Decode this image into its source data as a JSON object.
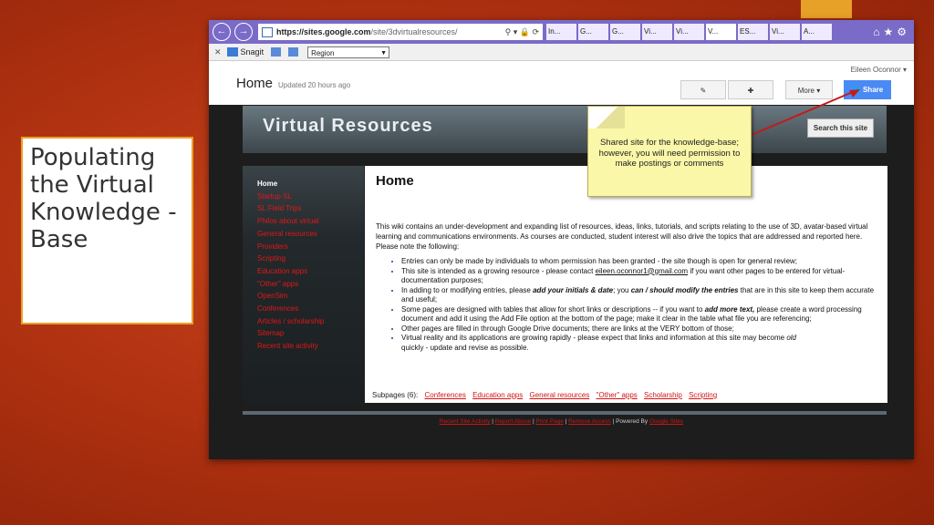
{
  "slide": {
    "text": "Populating the Virtual Knowledge -Base",
    "accent_color": "#e8a128"
  },
  "browser": {
    "url_host": "https://sites.google.com",
    "url_path": "/site/3dvirtualresources/",
    "tabs": [
      "In...",
      "G...",
      "G...",
      "Vi...",
      "Vi...",
      "V...",
      "ES...",
      "Vi...",
      "A..."
    ],
    "snagit_label": "Snagit",
    "region_value": "Region"
  },
  "sites": {
    "user_name": "Eileen Oconnor",
    "page_title": "Home",
    "updated": "Updated 20 hours ago",
    "more_label": "More",
    "share_label": "Share",
    "site_title": "Virtual Resources",
    "search_label": "Search this site",
    "sidebar_items": [
      "Home",
      "Startup SL",
      "SL Field Trips",
      "Philos about virtual",
      "General resources",
      "Providers",
      "Scripting",
      "Education apps",
      "\"Other\" apps",
      "OpenSim",
      "Conferences",
      "Articles / scholarship",
      "Sitemap",
      "Recent site activity"
    ],
    "content_heading": "Home",
    "intro": "This wiki contains an under-development and expanding list of resources, ideas, links, tutorials, and scripts relating to the use of 3D, avatar-based virtual learning and communications environments.  As courses are conducted, student interest will also drive the topics that are addressed and reported here.  Please note the following:",
    "bullet1": "Entries can only be made by individuals to whom permission has been granted - the site though is open for general review;",
    "bullet2_a": "This site is intended as a growing resource - please contact",
    "bullet2_link": "eileen.oconnor1@gmail.com",
    "bullet2_b": "if you want other pages to be entered for virtual-documentation purposes;",
    "bullet3_a": "In adding to or modifying entries, please",
    "bullet3_red": "add your initials & date",
    "bullet3_b": "; you",
    "bullet3_bi": "can / should modify the entries",
    "bullet3_c": "that are in this site to keep them accurate and useful;",
    "bullet4_a": "Some pages are designed with tables that allow for short links or descriptions -- if you want to",
    "bullet4_bi": "add more text,",
    "bullet4_b": "please create a word processing document and add it using the Add File option at the bottom of the page; make it clear in the table what file you are referencing;",
    "bullet5": "Other pages are filled in through Google Drive documents; there are links at the VERY bottom of those;",
    "bullet6_a": "Virtual reality and its applications are growing rapidly - please expect that links and information at this site may become",
    "bullet6_i": "old",
    "bullet6_b": "quickly - update and revise as possible.",
    "subpages_label": "Subpages (6):",
    "subpages": [
      "Conferences",
      "Education apps",
      "General resources",
      "\"Other\" apps",
      "Scholarship",
      "Scripting"
    ],
    "footer": {
      "recent": "Recent Site Activity",
      "report": "Report Abuse",
      "print": "Print Page",
      "remove": "Remove Access",
      "powered": "Powered By",
      "google": "Google Sites"
    },
    "callout": "Shared site for the knowledge-base; however, you will need permission to make postings or comments"
  }
}
